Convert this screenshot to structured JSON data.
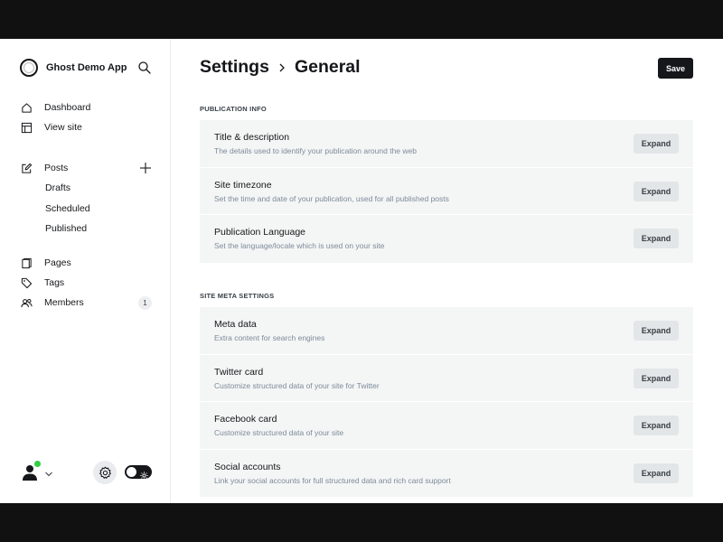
{
  "app": {
    "name": "Ghost Demo App"
  },
  "nav": {
    "dashboard": "Dashboard",
    "view_site": "View site",
    "posts": "Posts",
    "drafts": "Drafts",
    "scheduled": "Scheduled",
    "published": "Published",
    "pages": "Pages",
    "tags": "Tags",
    "members": "Members",
    "members_count": "1"
  },
  "header": {
    "parent": "Settings",
    "current": "General",
    "save_label": "Save"
  },
  "sections": {
    "publication_info": {
      "title": "PUBLICATION INFO",
      "rows": [
        {
          "title": "Title & description",
          "desc": "The details used to identify your publication around the web",
          "button": "Expand"
        },
        {
          "title": "Site timezone",
          "desc": "Set the time and date of your publication, used for all published posts",
          "button": "Expand"
        },
        {
          "title": "Publication Language",
          "desc": "Set the language/locale which is used on your site",
          "button": "Expand"
        }
      ]
    },
    "site_meta": {
      "title": "SITE META SETTINGS",
      "rows": [
        {
          "title": "Meta data",
          "desc": "Extra content for search engines",
          "button": "Expand"
        },
        {
          "title": "Twitter card",
          "desc": "Customize structured data of your site for Twitter",
          "button": "Expand"
        },
        {
          "title": "Facebook card",
          "desc": "Customize structured data of your site",
          "button": "Expand"
        },
        {
          "title": "Social accounts",
          "desc": "Link your social accounts for full structured data and rich card support",
          "button": "Expand"
        }
      ]
    }
  },
  "colors": {
    "primary": "#15171a",
    "panel": "#f4f5f5",
    "muted_text": "#7c8b9a",
    "online": "#30cf43"
  }
}
